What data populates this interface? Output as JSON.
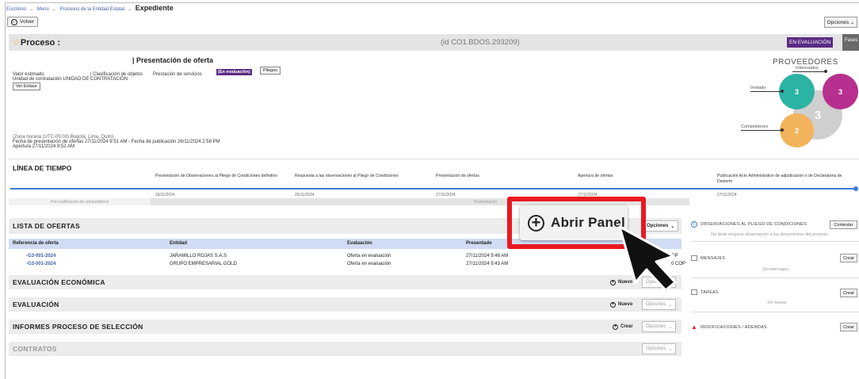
{
  "breadcrumb": {
    "items": [
      "Escritorio",
      "Menú",
      "Procesos de la Entidad Estatal"
    ],
    "current": "Expediente",
    "separator": "→"
  },
  "toolbar": {
    "back_label": "Volver",
    "options_label": "Opciones"
  },
  "process": {
    "title": "Proceso :",
    "id": "(id CO1.BDOS.293209)",
    "status_badge": "EN EVALUACIÓN",
    "phases_label": "Fases",
    "presentation_title": "| Presentación de oferta",
    "estimated_value_label": "Valor estimado",
    "classification_label": "| Clasificación de objetos",
    "service_label": "Prestación de servicios",
    "status_tag": "(En evaluación)",
    "pliego_btn": "Pliegos",
    "unit_line": "Unidad de contratación UNIDAD DE CONTRATACIÓN",
    "link_btn": "Ver Enlace",
    "timezone": "(Zona horaria (UTC-05:00) Bogotá, Lima, Quito)",
    "offers_deadline": "Fecha de presentación de ofertas 27/11/2024 9:51 AM - Fecha de publicación 26/11/2024 2:58 PM",
    "opening": "Apertura 27/11/2024 9:52 AM"
  },
  "providers": {
    "title": "PROVEEDORES",
    "interested_label": "Interesados",
    "invited_label": "Invitado",
    "competitors_label": "Competidores",
    "invited": "3",
    "interested": "3",
    "total": "3",
    "competitors": "2"
  },
  "timeline": {
    "title": "LÍNEA DE TIEMPO",
    "columns": [
      {
        "label": "Presentación de Observaciones al Pliego de Condiciones definitivo",
        "date": "26/11/2024"
      },
      {
        "label": "Respuesta a las observaciones al Pliego de Condiciones",
        "date": "26/11/2024"
      },
      {
        "label": "Presentación de ofertas",
        "date": "27/11/2024"
      },
      {
        "label": "Apertura de ofertas",
        "date": "27/11/2024"
      },
      {
        "label": "Publicación Acto Administrativo de adjudicación o de Declaratoria de Desierto",
        "date": "27/11/2024"
      }
    ],
    "pre_label": "Pré-Calificación de competidores",
    "presented_label": "Presentación"
  },
  "offers": {
    "title": "LISTA DE OFERTAS",
    "options_label": "Opciones",
    "headers": [
      "Referencia de oferta",
      "Entidad",
      "Evaluación",
      "Presentado"
    ],
    "rows": [
      {
        "ref": "-G3-001-2024",
        "entity": "JARAMILLO ROJAS S.A.S",
        "eval": "Oferta en evaluación",
        "date": "27/11/2024 9:48 AM",
        "amount": "000 COP"
      },
      {
        "ref": "-G3-001-2024",
        "entity": "GRUPO EMPRESARIAL GOLD",
        "eval": "Oferta en evaluación",
        "date": "27/11/2024 9:43 AM",
        "amount": "0 COP"
      }
    ]
  },
  "sections": {
    "economic": {
      "title": "EVALUACIÓN ECONÓMICA",
      "action": "Nuevo",
      "options": "Opciones"
    },
    "evaluation": {
      "title": "EVALUACIÓN",
      "action": "Nuevo",
      "options": "Opciones"
    },
    "reports": {
      "title": "INFORMES PROCESO DE SELECCIÓN",
      "action": "Crear",
      "options": "Opciones"
    },
    "contracts": {
      "title": "CONTRATOS",
      "options": "Opciones"
    }
  },
  "right_panel": {
    "observations": {
      "title": "OBSERVACIONES AL PLIEGO DE CONDICIONES",
      "button": "Contestar",
      "empty": "No tiene ninguna observación a los documentos del proceso"
    },
    "messages": {
      "title": "MENSAJES",
      "button": "Crear",
      "empty": "Sin mensajes"
    },
    "tasks": {
      "title": "TAREAS",
      "button": "Crear",
      "empty": "Sin tareas"
    },
    "amendments": {
      "title": "MODIFICACIONES / ADENDAS",
      "button": "Crear"
    }
  },
  "callout": {
    "label": "Abrir Panel",
    "color": "#e8191f"
  },
  "colors": {
    "purple": "#5b2b83",
    "teal": "#2bb3a3",
    "magenta": "#b8308f",
    "orange": "#f2b35b",
    "blue": "#3b7dd8"
  }
}
